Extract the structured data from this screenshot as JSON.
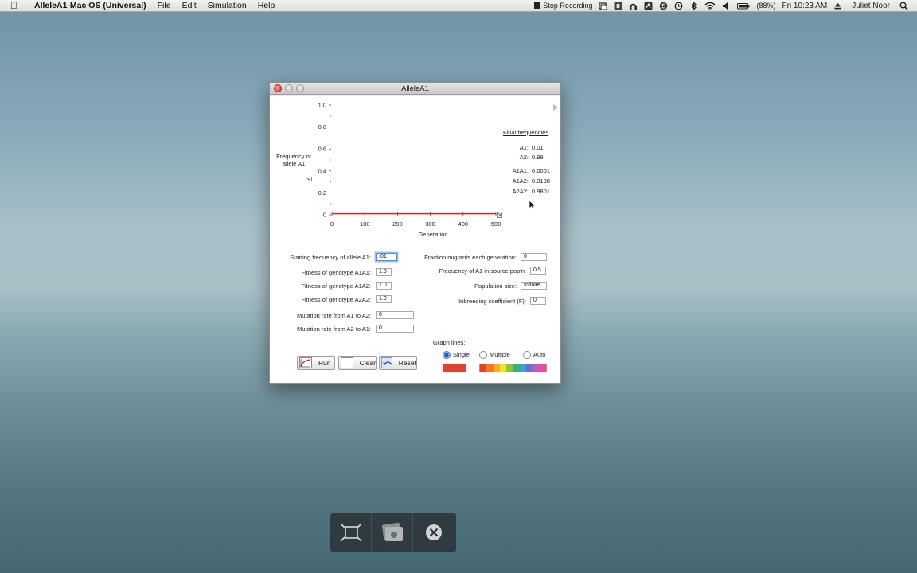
{
  "menubar": {
    "app_name": "AlleleA1-Mac OS (Universal)",
    "items": [
      "File",
      "Edit",
      "Simulation",
      "Help"
    ],
    "stop_recording": "Stop Recording",
    "battery": "(88%)",
    "clock": "Fri 10:23 AM",
    "user": "Juliet Noor"
  },
  "window": {
    "title": "AlleleA1"
  },
  "chart_data": {
    "type": "line",
    "title": "",
    "xlabel": "Generation",
    "ylabel": "Frequency of allele A1",
    "ylabel_line1": "Frequency of",
    "ylabel_line2": "allele A1",
    "xlim": [
      0,
      500
    ],
    "ylim": [
      0,
      1.0
    ],
    "x_ticks": [
      "0",
      "100",
      "200",
      "300",
      "400",
      "500"
    ],
    "y_ticks": [
      "0",
      "0.2",
      "0.4",
      "0.6",
      "0.8",
      "1.0"
    ],
    "series": [
      {
        "color": "#e0261b",
        "x": [
          0,
          500
        ],
        "y": [
          0.01,
          0.01
        ]
      }
    ]
  },
  "final_frequencies": {
    "heading": "Final frequencies",
    "A1_label": "A1:",
    "A1_value": "0.01",
    "A2_label": "A2:",
    "A2_value": "0.99",
    "A1A1_label": "A1A1:",
    "A1A1_value": "0.0001",
    "A1A2_label": "A1A2:",
    "A1A2_value": "0.0198",
    "A2A2_label": "A2A2:",
    "A2A2_value": "0.9801"
  },
  "params": {
    "start_freq_label": "Starting frequency of allele A1:",
    "start_freq_value": ".01",
    "fit_a1a1_label": "Fitness of genotype A1A1:",
    "fit_a1a1_value": "1.0",
    "fit_a1a2_label": "Fitness of genotype A1A2:",
    "fit_a1a2_value": "1.0",
    "fit_a2a2_label": "Fitness of genotype A2A2:",
    "fit_a2a2_value": "1.0",
    "mut_a1a2_label": "Mutation rate from A1 to A2:",
    "mut_a1a2_value": "0",
    "mut_a2a1_label": "Mutation rate from A2 to A1:",
    "mut_a2a1_value": "0",
    "migrants_label": "Fraction migrants each generation:",
    "migrants_value": "0",
    "source_freq_label": "Frequency of A1 in source pop'n:",
    "source_freq_value": "0.5",
    "pop_size_label": "Population size:",
    "pop_size_value": "Infinite",
    "inbreeding_label": "Inbreeding coefficient (F):",
    "inbreeding_value": "0"
  },
  "buttons": {
    "run": "Run",
    "clear": "Clear",
    "reset": "Reset"
  },
  "graph_lines": {
    "heading": "Graph lines:",
    "single": "Single",
    "multiple": "Multiple",
    "auto": "Auto",
    "single_color": "#e2412c",
    "palette": [
      "#e2412c",
      "#ef7a22",
      "#f2b31e",
      "#f3e323",
      "#8cc63f",
      "#3fb07a",
      "#3aa0d6",
      "#6f6fd0",
      "#c058c9",
      "#e9508e"
    ]
  }
}
